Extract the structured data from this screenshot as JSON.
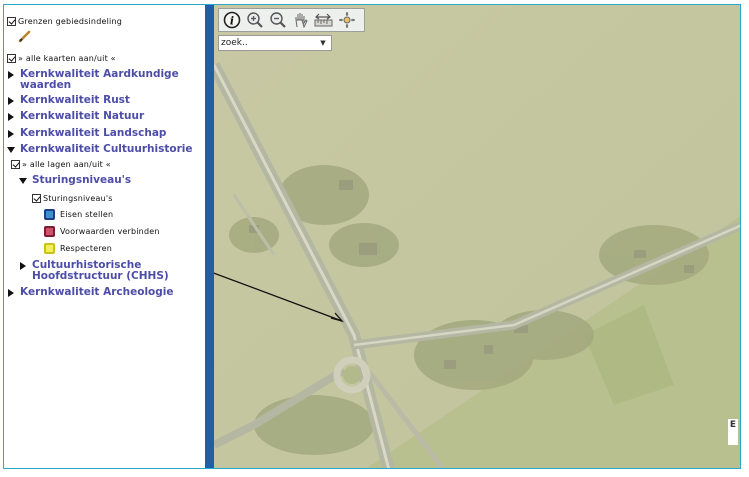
{
  "sidebar": {
    "boundaries_label": "Grenzen gebiedsindeling",
    "all_maps_toggle": "» alle kaarten aan/uit «",
    "categories": [
      {
        "label": "Kernkwaliteit Aardkundige waarden"
      },
      {
        "label": "Kernkwaliteit Rust"
      },
      {
        "label": "Kernkwaliteit Natuur"
      },
      {
        "label": "Kernkwaliteit Landschap"
      },
      {
        "label": "Kernkwaliteit Cultuurhistorie"
      },
      {
        "label": "Kernkwaliteit Archeologie"
      }
    ],
    "all_layers_toggle": "» alle lagen aan/uit «",
    "sub_sturing": "Sturingsniveau's",
    "layer_sturing": "Sturingsniveau's",
    "legend": [
      {
        "label": "Eisen stellen",
        "color": "#3d8fd0",
        "border": "#1c3e86"
      },
      {
        "label": "Voorwaarden verbinden",
        "color": "#d1506c",
        "border": "#7a1e33"
      },
      {
        "label": "Respecteren",
        "color": "#f3ef5a",
        "border": "#c9c217"
      }
    ],
    "sub_chhs": "Cultuurhistorische Hoofdstructuur (CHHS)"
  },
  "map": {
    "search_value": "zoek..",
    "tools": [
      "info-icon",
      "zoom-in-icon",
      "zoom-out-icon",
      "pan-hand-icon",
      "measure-icon",
      "locate-icon"
    ],
    "edge_label": "E"
  }
}
